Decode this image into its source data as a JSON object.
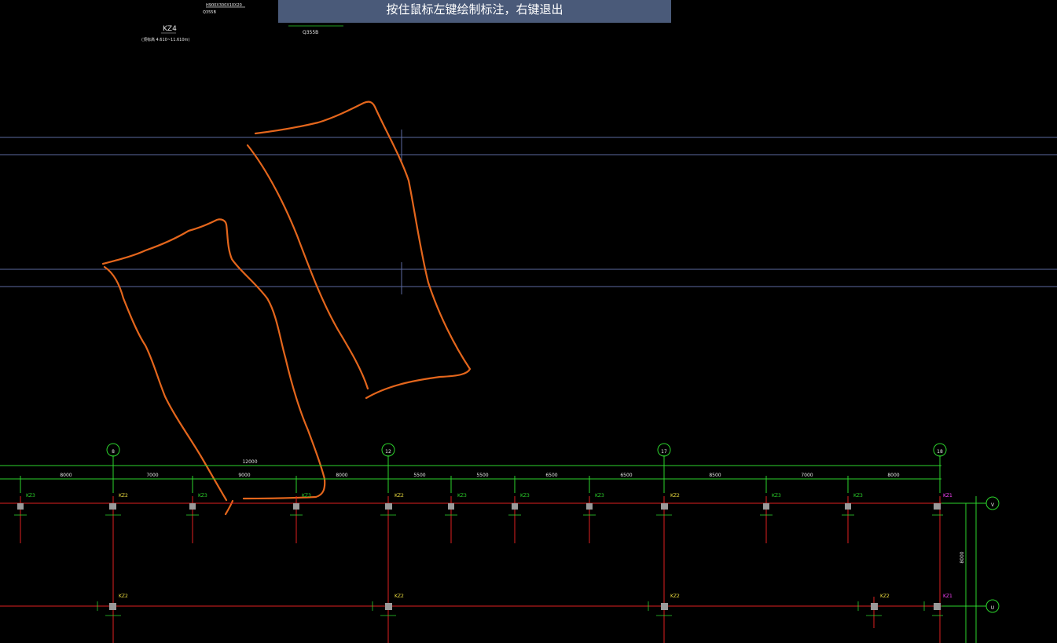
{
  "prompt": {
    "text": "按住鼠标左键绘制标注，右键退出"
  },
  "header_notes": {
    "note1": "H900X300X10X20",
    "note2": "Q355B",
    "note3": "KZ4",
    "note4": "(顶标高 4.610~11.610m)",
    "note5": "Q355B"
  },
  "grid_axes": [
    {
      "label": "8"
    },
    {
      "label": "12"
    },
    {
      "label": "17"
    },
    {
      "label": "18"
    }
  ],
  "row_axes": [
    {
      "label": "V"
    },
    {
      "label": "U"
    }
  ],
  "overall_dimension": "12000",
  "row_dimension": "8000",
  "bay_dimensions": [
    "8000",
    "7000",
    "9000",
    "8000",
    "5500",
    "5500",
    "6500",
    "6500",
    "8500",
    "7000",
    "8000"
  ],
  "column_tags": {
    "KZ3": "KZ3",
    "KZ2": "KZ2",
    "KZ1": "KZ1"
  },
  "colors": {
    "background": "#000000",
    "grid_line": "#5b6aa0",
    "annotation": "#e4661c",
    "dimension": "#2cd42c",
    "axis_line": "#e02020",
    "tag": "#f0e040",
    "magenta": "#ff44ff"
  }
}
